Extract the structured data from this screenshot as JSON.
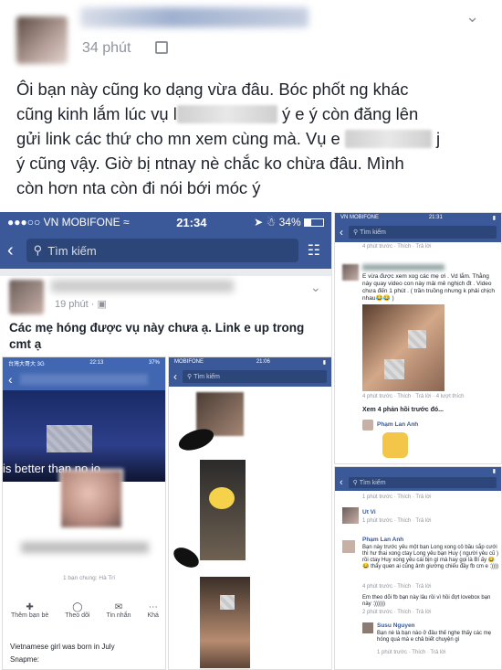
{
  "post": {
    "time": "34 phút",
    "text_line1": "Ôi bạn này cũng ko dạng vừa đâu. Bóc phốt ng khác",
    "text_line2a": "cũng kinh lắm lúc vụ l",
    "text_line2b": "ý e ý còn đăng lên",
    "text_line3a": "gửi link các thứ cho mn xem cùng mà. Vụ e",
    "text_line3b": "j",
    "text_line4": "ý cũng vậy. Giờ bị ntnay nè chắc ko chừa đâu. Mình",
    "text_line5": "còn hơn nta còn đi nói bới móc ý"
  },
  "phone": {
    "carrier": "VN MOBIFONE",
    "clock": "21:34",
    "battery": "34%",
    "search_placeholder": "Tìm kiếm",
    "post_time": "19 phút",
    "post_text": "Các mẹ hóng được vụ này chưa ạ. Link e up trong cmt ạ"
  },
  "inner_left": {
    "carrier": "台灣大哥大 3G",
    "clock": "22:13",
    "banner_text": "is better than no jo",
    "mutual": "1 bạn chung: Hà Trí",
    "actions": [
      "Thêm bạn bè",
      "Theo dõi",
      "Tin nhắn",
      "Khá"
    ],
    "bio": "Vietnamese girl was born in July",
    "snapchat": "Snapme:"
  },
  "inner_mid": {
    "carrier": "MOBIFONE",
    "clock": "21:06",
    "search_placeholder": "Tìm kiếm"
  },
  "right_top": {
    "carrier": "VN MOBIFONE",
    "clock": "21:31",
    "search_placeholder": "Tìm kiếm",
    "meta1": "4 phút trước · Thích · Trả lời",
    "comment_text": "E vừa được xem xog các mẹ ơi . Vd lắm. Thằng này quay video con này mải mê nghịch đt . Video chưa đến 1 phút . ( trần truồng nhưng k phải chịch nhau😂😂 )",
    "meta2": "4 phút trước · Thích · Trả lời · 4 lượt thích",
    "see_more": "Xem 4 phản hồi trước đó...",
    "reply_name": "Phạm Lan Anh"
  },
  "right_bottom": {
    "search_placeholder": "Tìm kiếm",
    "meta0": "1 phút trước · Thích · Trả lời",
    "c1_name": "Ut Vi",
    "c1_meta": "1 phút trước · Thích · Trả lời",
    "c2_name": "Phạm Lan Anh",
    "c2_text": "Bạn này trước yêu một bạn Long xong cô bầu sắp cưới thì hư thai xong ctay Long yêu bạn Huy ( người yêu cũ ) rồi ctay Huy xong yêu cái bịn gì mà hay gọi là Bí ấy 😂😂 thấy quen ai cũng ảnh giường chiếu đầy fb cm e :))))",
    "c2_meta": "4 phút trước · Thích · Trả lời",
    "c3_text": "Em theo dõi fb bạn này lâu rồi vì hồi đợt lovebox bạn này :))))))",
    "c3_meta": "2 phút trước · Thích · Trả lời",
    "c4_name": "Susu Nguyen",
    "c4_text": "Bạn nè là bạn nào ở đâu thế nghe thấy các mẹ hóng quá mà e chả biết chuyện gì",
    "c4_meta": "1 phút trước · Thích · Trả lời"
  }
}
